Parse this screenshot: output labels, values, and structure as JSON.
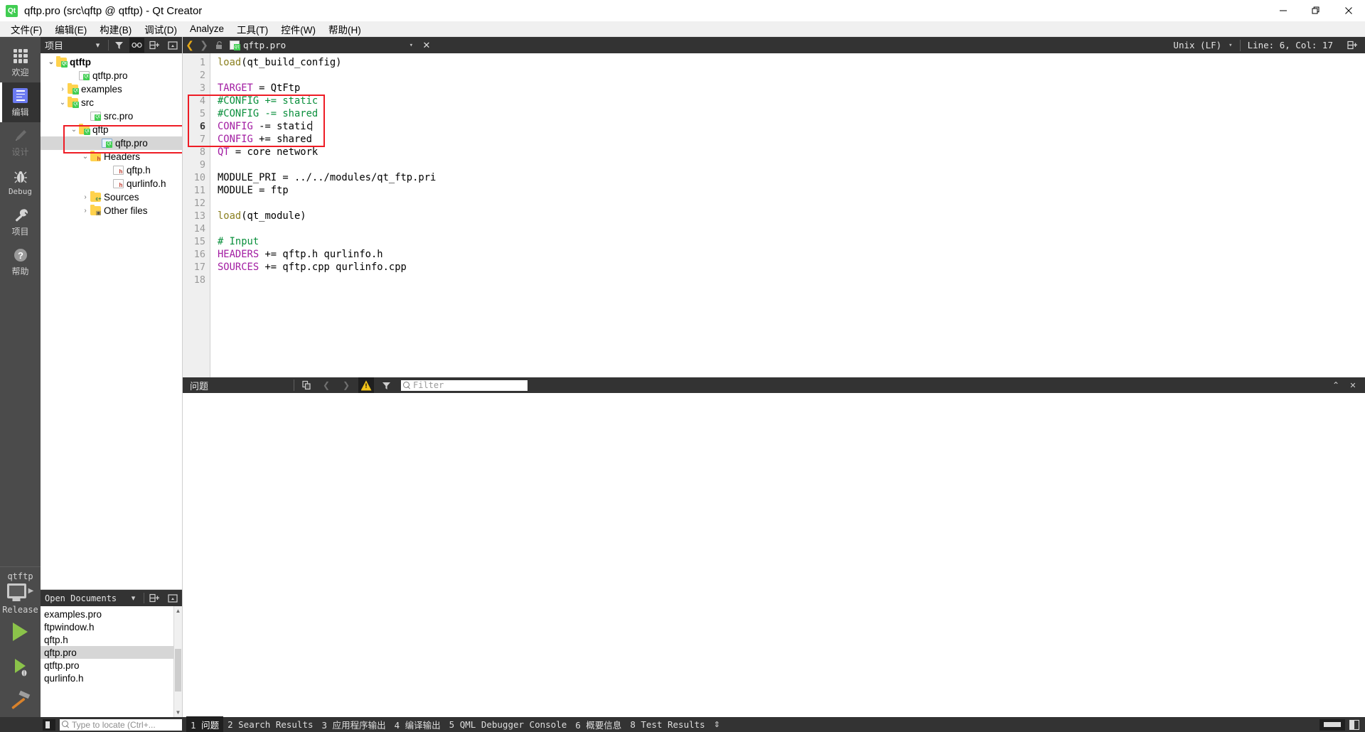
{
  "window": {
    "title": "qftp.pro (src\\qftp @ qtftp) - Qt Creator",
    "app_icon": "qt-logo-icon",
    "minimize": "minimize-icon",
    "maximize": "restore-icon",
    "close": "close-icon"
  },
  "menubar": {
    "items": [
      {
        "label": "文件(F)",
        "mnemonic": "F"
      },
      {
        "label": "编辑(E)",
        "mnemonic": "E"
      },
      {
        "label": "构建(B)",
        "mnemonic": "B"
      },
      {
        "label": "调试(D)",
        "mnemonic": "D"
      },
      {
        "label": "Analyze",
        "mnemonic": "A"
      },
      {
        "label": "工具(T)",
        "mnemonic": "T"
      },
      {
        "label": "控件(W)",
        "mnemonic": "W"
      },
      {
        "label": "帮助(H)",
        "mnemonic": "H"
      }
    ]
  },
  "modebar": {
    "modes": [
      {
        "label": "欢迎",
        "icon": "grid-icon",
        "active": false,
        "disabled": false
      },
      {
        "label": "编辑",
        "icon": "document-edit-icon",
        "active": true,
        "disabled": false
      },
      {
        "label": "设计",
        "icon": "pencil-icon",
        "active": false,
        "disabled": true
      },
      {
        "label": "Debug",
        "icon": "bug-icon",
        "active": false,
        "disabled": false
      },
      {
        "label": "项目",
        "icon": "wrench-icon",
        "active": false,
        "disabled": false
      },
      {
        "label": "帮助",
        "icon": "question-mark-icon",
        "active": false,
        "disabled": false
      }
    ],
    "kit": {
      "project_name": "qtftp",
      "build_config": "Release",
      "run_label": "run-button",
      "debug_label": "start-debugging-button",
      "build_label": "build-project-button"
    }
  },
  "project_panel": {
    "title": "项目",
    "toolbar": [
      {
        "name": "filter-icon"
      },
      {
        "name": "link-with-editor-icon",
        "active": true
      },
      {
        "name": "split-add-icon"
      },
      {
        "name": "collapse-panel-icon"
      }
    ],
    "tree": [
      {
        "label": "qtftp",
        "depth": 0,
        "chevron": "down",
        "icon": "folder-qt",
        "bold": true,
        "selected": false
      },
      {
        "label": "qtftp.pro",
        "depth": 2,
        "chevron": "",
        "icon": "file-qt",
        "bold": false,
        "selected": false
      },
      {
        "label": "examples",
        "depth": 1,
        "chevron": "right",
        "icon": "folder-qt",
        "bold": false,
        "selected": false
      },
      {
        "label": "src",
        "depth": 1,
        "chevron": "down",
        "icon": "folder-qt",
        "bold": false,
        "selected": false
      },
      {
        "label": "src.pro",
        "depth": 3,
        "chevron": "",
        "icon": "file-qt",
        "bold": false,
        "selected": false
      },
      {
        "label": "qftp",
        "depth": 2,
        "chevron": "down",
        "icon": "folder-qt",
        "bold": false,
        "selected": false
      },
      {
        "label": "qftp.pro",
        "depth": 4,
        "chevron": "",
        "icon": "file-qt-selected",
        "bold": false,
        "selected": true
      },
      {
        "label": "Headers",
        "depth": 3,
        "chevron": "down",
        "icon": "folder-h",
        "bold": false,
        "selected": false
      },
      {
        "label": "qftp.h",
        "depth": 5,
        "chevron": "",
        "icon": "file-h",
        "bold": false,
        "selected": false
      },
      {
        "label": "qurlinfo.h",
        "depth": 5,
        "chevron": "",
        "icon": "file-h",
        "bold": false,
        "selected": false
      },
      {
        "label": "Sources",
        "depth": 3,
        "chevron": "right",
        "icon": "folder-c",
        "bold": false,
        "selected": false
      },
      {
        "label": "Other files",
        "depth": 3,
        "chevron": "right",
        "icon": "folder-o",
        "bold": false,
        "selected": false
      }
    ]
  },
  "open_documents": {
    "title": "Open Documents",
    "toolbar": [
      {
        "name": "chevron-down-icon"
      },
      {
        "name": "split-add-icon"
      },
      {
        "name": "collapse-panel-icon"
      }
    ],
    "items": [
      {
        "label": "examples.pro",
        "selected": false
      },
      {
        "label": "ftpwindow.h",
        "selected": false
      },
      {
        "label": "qftp.h",
        "selected": false
      },
      {
        "label": "qftp.pro",
        "selected": true
      },
      {
        "label": "qtftp.pro",
        "selected": false
      },
      {
        "label": "qurlinfo.h",
        "selected": false
      }
    ]
  },
  "editor_toolbar": {
    "back_icon": "back-arrow-icon",
    "forward_icon": "forward-arrow-icon",
    "lock_icon": "unlocked-icon",
    "document_name": "qftp.pro",
    "document_icon": "file-qt-icon",
    "dropdown_icon": "chevron-down-icon",
    "close_icon": "close-icon",
    "line_ending": "Unix (LF)",
    "line_ending_dropdown": "chevron-down-icon",
    "cursor_position": "Line: 6, Col: 17",
    "split_icon": "split-editor-icon"
  },
  "editor": {
    "lines": [
      {
        "n": 1,
        "tokens": [
          {
            "t": "load",
            "c": "func"
          },
          {
            "t": "(qt_build_config)",
            "c": "plain"
          }
        ]
      },
      {
        "n": 2,
        "tokens": []
      },
      {
        "n": 3,
        "tokens": [
          {
            "t": "TARGET",
            "c": "var"
          },
          {
            "t": " = QtFtp",
            "c": "plain"
          }
        ]
      },
      {
        "n": 4,
        "tokens": [
          {
            "t": "#CONFIG += static",
            "c": "cmt"
          }
        ]
      },
      {
        "n": 5,
        "tokens": [
          {
            "t": "#CONFIG -= shared",
            "c": "cmt"
          }
        ]
      },
      {
        "n": 6,
        "tokens": [
          {
            "t": "CONFIG",
            "c": "var"
          },
          {
            "t": " -= static",
            "c": "plain"
          }
        ],
        "cursor": true,
        "current": true
      },
      {
        "n": 7,
        "tokens": [
          {
            "t": "CONFIG",
            "c": "var"
          },
          {
            "t": " += shared",
            "c": "plain"
          }
        ]
      },
      {
        "n": 8,
        "tokens": [
          {
            "t": "QT",
            "c": "var"
          },
          {
            "t": " = core network",
            "c": "plain"
          }
        ]
      },
      {
        "n": 9,
        "tokens": []
      },
      {
        "n": 10,
        "tokens": [
          {
            "t": "MODULE_PRI = ../../modules/qt_ftp.pri",
            "c": "plain"
          }
        ]
      },
      {
        "n": 11,
        "tokens": [
          {
            "t": "MODULE = ftp",
            "c": "plain"
          }
        ]
      },
      {
        "n": 12,
        "tokens": []
      },
      {
        "n": 13,
        "tokens": [
          {
            "t": "load",
            "c": "func"
          },
          {
            "t": "(qt_module)",
            "c": "plain"
          }
        ]
      },
      {
        "n": 14,
        "tokens": []
      },
      {
        "n": 15,
        "tokens": [
          {
            "t": "# Input",
            "c": "cmt"
          }
        ]
      },
      {
        "n": 16,
        "tokens": [
          {
            "t": "HEADERS",
            "c": "var"
          },
          {
            "t": " += qftp.h qurlinfo.h",
            "c": "plain"
          }
        ]
      },
      {
        "n": 17,
        "tokens": [
          {
            "t": "SOURCES",
            "c": "var"
          },
          {
            "t": " += qftp.cpp qurlinfo.cpp",
            "c": "plain"
          }
        ]
      },
      {
        "n": 18,
        "tokens": []
      }
    ],
    "highlight_annotation": {
      "from_line": 4,
      "to_line": 7,
      "color": "#ee1c25"
    }
  },
  "issues_panel": {
    "title": "问题",
    "toolbar": [
      {
        "name": "copy-issues-icon"
      },
      {
        "name": "previous-item-icon"
      },
      {
        "name": "next-item-icon"
      },
      {
        "name": "warning-filter-icon"
      },
      {
        "name": "filter-icon"
      }
    ],
    "filter_placeholder": "Filter",
    "search_icon": "search-icon",
    "maximize_icon": "chevron-up-icon",
    "close_icon": "close-icon"
  },
  "statusbar": {
    "sidebar_toggle_icon": "toggle-sidebar-icon",
    "locator_placeholder": "Type to locate (Ctrl+...",
    "locator_icon": "search-icon",
    "tabs": [
      {
        "num": "1",
        "label": "问题",
        "active": true
      },
      {
        "num": "2",
        "label": "Search Results",
        "active": false
      },
      {
        "num": "3",
        "label": "应用程序输出",
        "active": false
      },
      {
        "num": "4",
        "label": "编译输出",
        "active": false
      },
      {
        "num": "5",
        "label": "QML Debugger Console",
        "active": false
      },
      {
        "num": "6",
        "label": "概要信息",
        "active": false
      },
      {
        "num": "8",
        "label": "Test Results",
        "active": false
      }
    ],
    "updown_icon": "up-down-arrows-icon",
    "progress_icon": "progress-bar-icon",
    "split_icon": "split-view-icon"
  },
  "colors": {
    "dark_chrome": "#333333",
    "modebar": "#4b4b4b",
    "accent_green": "#41cd52",
    "annotation_red": "#ee1c25",
    "selection_grey": "#d6d6d6",
    "keyword_purple": "#a21ca2",
    "comment_green": "#0a8f3c",
    "function_olive": "#8a7f1e"
  }
}
